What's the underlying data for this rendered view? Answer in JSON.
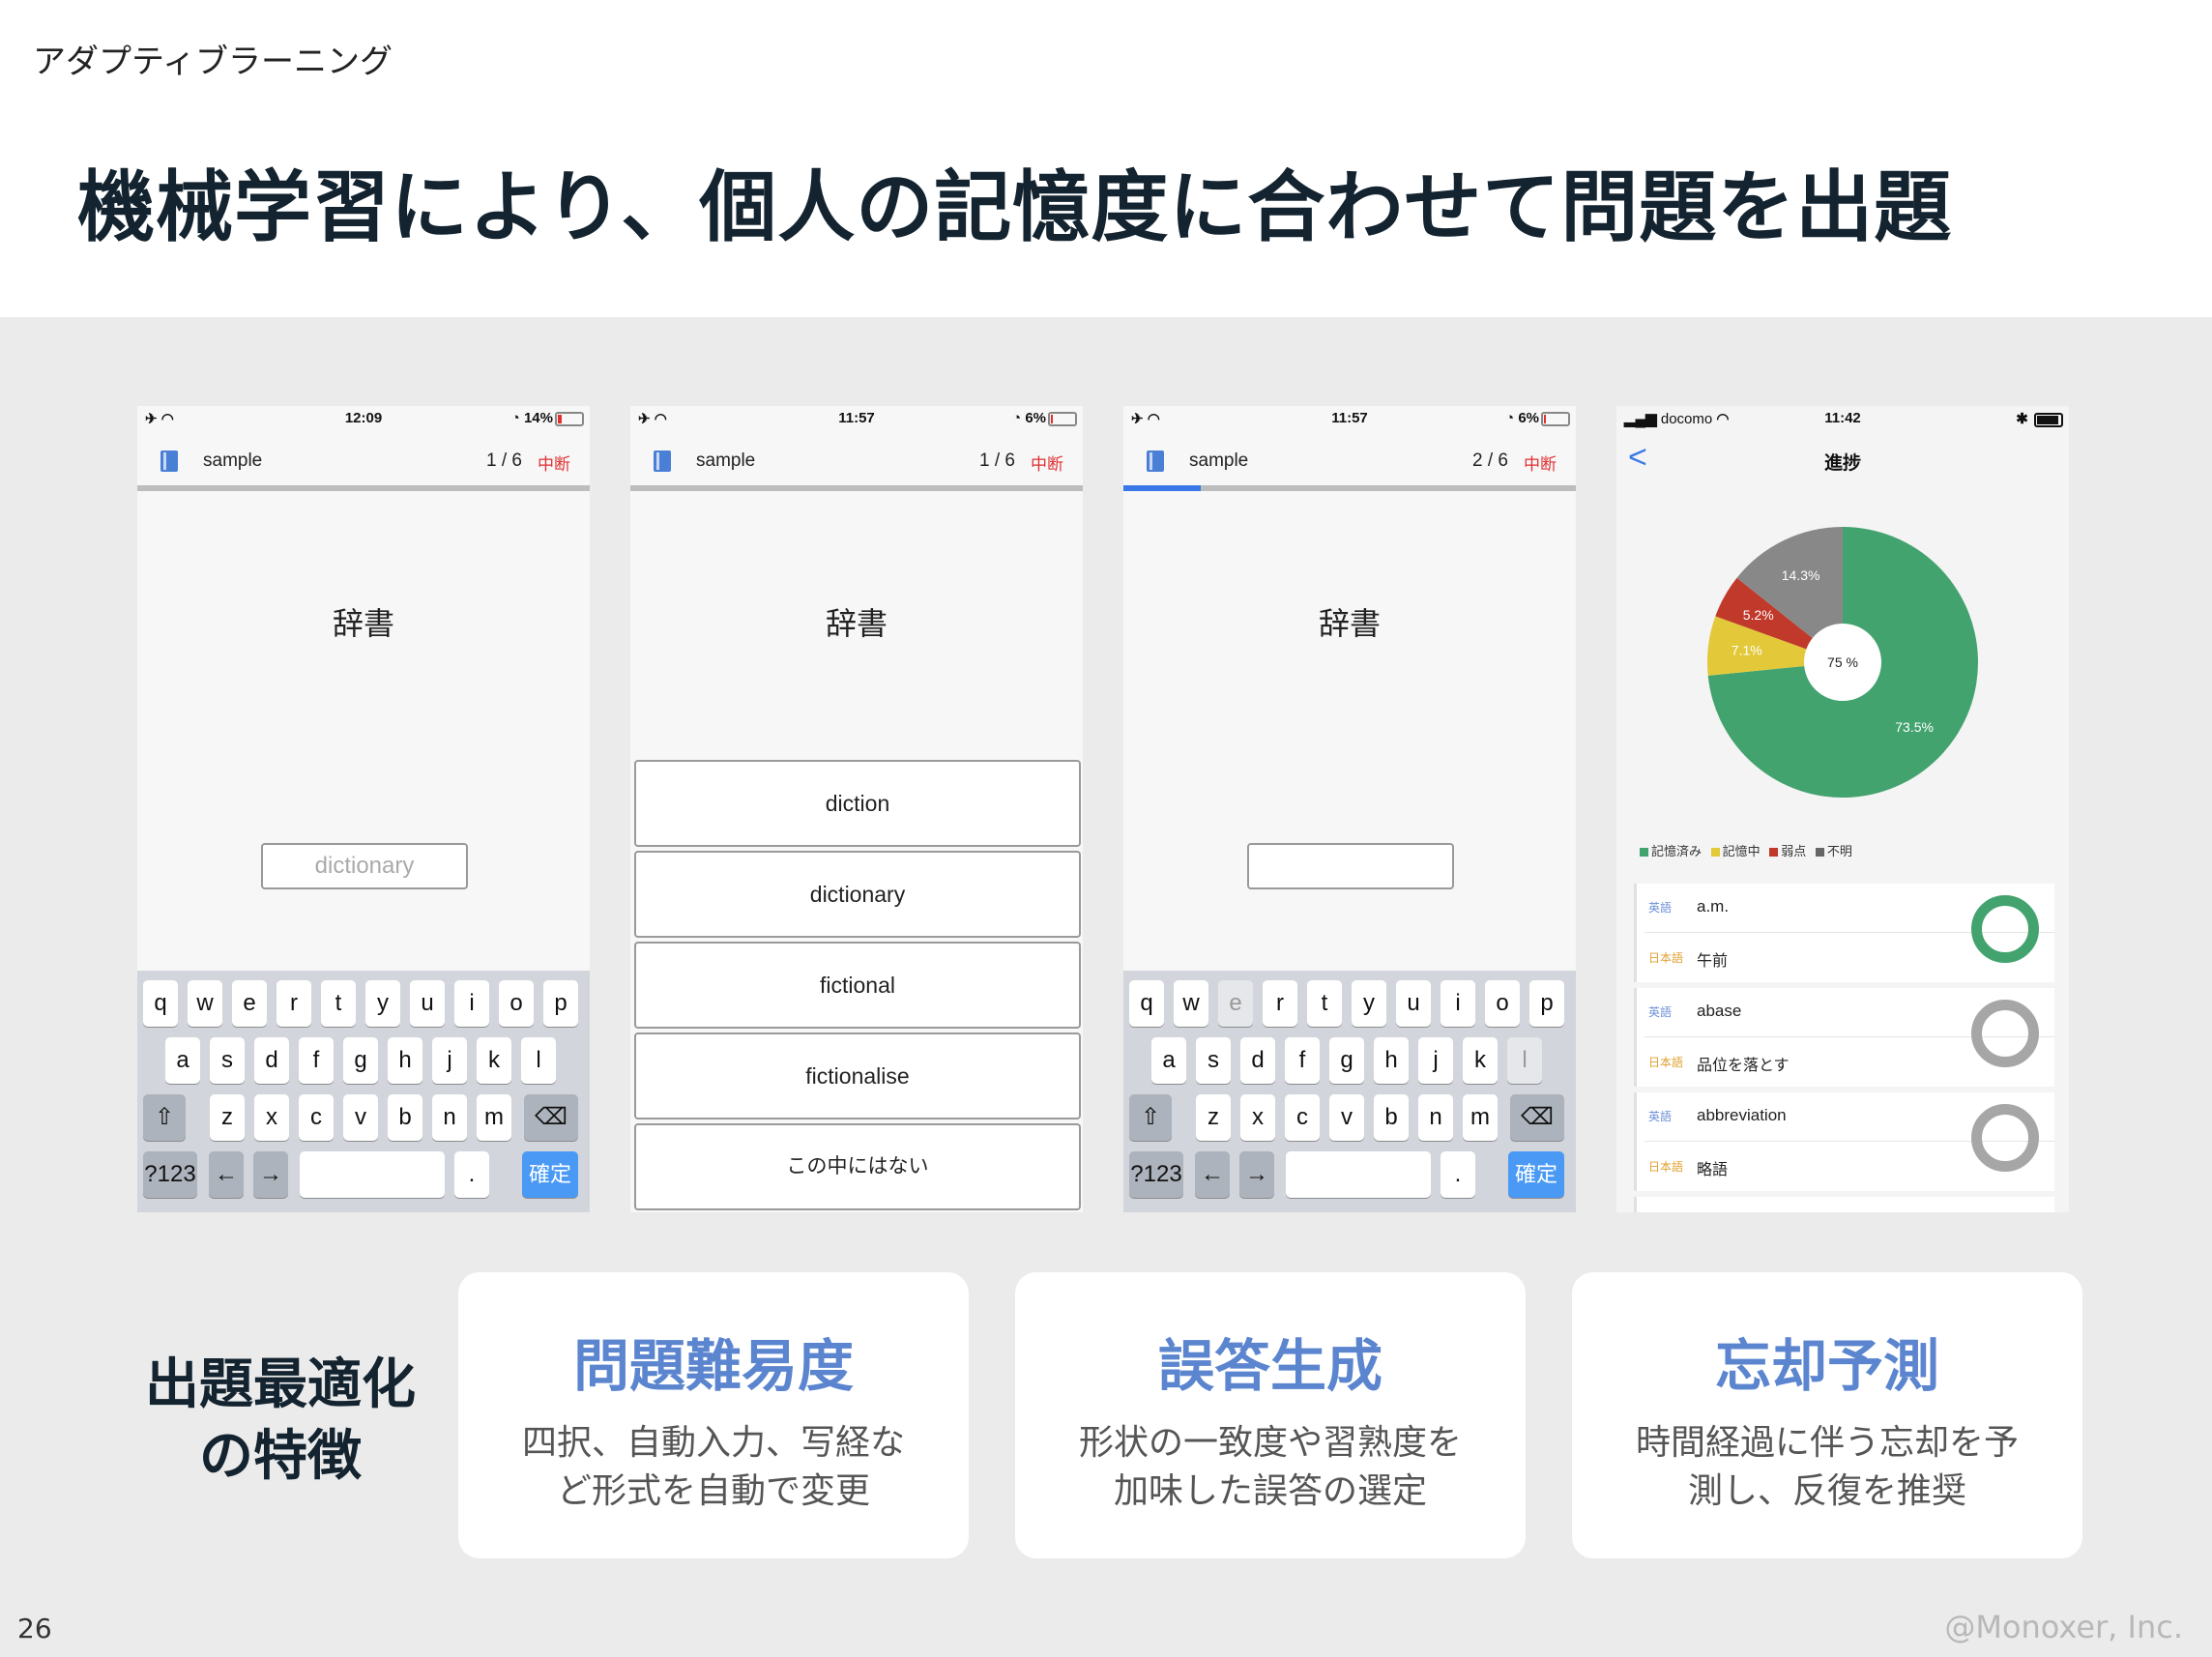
{
  "header": {
    "section": "アダプティブラーニング",
    "title": "機械学習により、個人の記憶度に合わせて問題を出題"
  },
  "phones": {
    "p1": {
      "time": "12:09",
      "battery": "14%",
      "app": "sample",
      "counter": "1 / 6",
      "stop": "中断",
      "question": "辞書",
      "answer": "dictionary",
      "progress": 0
    },
    "p2": {
      "time": "11:57",
      "battery": "6%",
      "app": "sample",
      "counter": "1 / 6",
      "stop": "中断",
      "question": "辞書",
      "progress": 0,
      "choices": [
        "diction",
        "dictionary",
        "fictional",
        "fictionalise",
        "この中にはない"
      ]
    },
    "p3": {
      "time": "11:57",
      "battery": "6%",
      "app": "sample",
      "counter": "2 / 6",
      "stop": "中断",
      "question": "辞書",
      "answer": "",
      "progress": 0.17
    },
    "p4": {
      "carrier": "docomo",
      "time": "11:42",
      "title": "進捗",
      "back": "<",
      "legend": [
        "記憶済み",
        "記憶中",
        "弱点",
        "不明"
      ],
      "words": [
        {
          "tag_en": "英語",
          "en": "a.m.",
          "tag_jp": "日本語",
          "jp": "午前",
          "status": "memorized"
        },
        {
          "tag_en": "英語",
          "en": "abase",
          "tag_jp": "日本語",
          "jp": "品位を落とす",
          "status": "unknown"
        },
        {
          "tag_en": "英語",
          "en": "abbreviation",
          "tag_jp": "日本語",
          "jp": "略語",
          "status": "unknown"
        }
      ]
    }
  },
  "keyboard": {
    "row1": [
      "q",
      "w",
      "e",
      "r",
      "t",
      "y",
      "u",
      "i",
      "o",
      "p"
    ],
    "row2": [
      "a",
      "s",
      "d",
      "f",
      "g",
      "h",
      "j",
      "k",
      "l"
    ],
    "row3": [
      "z",
      "x",
      "c",
      "v",
      "b",
      "n",
      "m"
    ],
    "shift": "⇧",
    "backspace": "⌫",
    "num": "?123",
    "left": "←",
    "right": "→",
    "period": ".",
    "confirm": "確定"
  },
  "chart_data": {
    "type": "pie",
    "title": "",
    "center_label": "75 %",
    "slices": [
      {
        "label": "記憶済み",
        "value": 73.5,
        "color": "#43a36f",
        "text": "73.5%"
      },
      {
        "label": "記憶中",
        "value": 7.1,
        "color": "#e3c93a",
        "text": "7.1%"
      },
      {
        "label": "弱点",
        "value": 5.2,
        "color": "#c0392b",
        "text": "5.2%"
      },
      {
        "label": "不明",
        "value": 14.3,
        "color": "#888888",
        "text": "14.3%"
      }
    ],
    "legend": "bottom"
  },
  "features": {
    "heading_line1": "出題最適化",
    "heading_line2": "の特徴",
    "cards": [
      {
        "title": "問題難易度",
        "line1": "四択、自動入力、写経な",
        "line2": "ど形式を自動で変更"
      },
      {
        "title": "誤答生成",
        "line1": "形状の一致度や習熟度を",
        "line2": "加味した誤答の選定"
      },
      {
        "title": "忘却予測",
        "line1": "時間経過に伴う忘却を予",
        "line2": "測し、反復を推奨"
      }
    ]
  },
  "footer": {
    "page": "26",
    "copyright": "@Monoxer, Inc."
  }
}
